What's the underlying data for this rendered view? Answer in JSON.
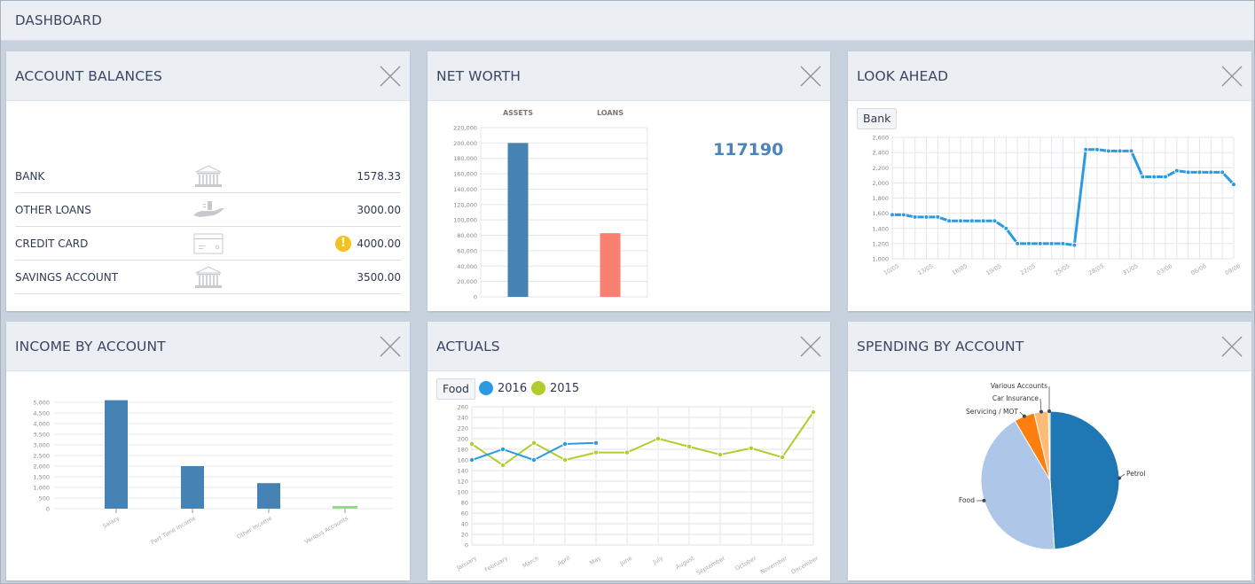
{
  "app": {
    "title": "DASHBOARD"
  },
  "colors": {
    "accent": "#4682b4",
    "loans": "#fa8072",
    "series_2016": "#2b9ae2",
    "series_2015": "#b3cc2c",
    "warning": "#f3c220",
    "lookahead_line": "#2b9ae2"
  },
  "panels": {
    "account_balances": {
      "title": "ACCOUNT BALANCES",
      "close_icon": "close-icon",
      "rows": [
        {
          "name": "BANK",
          "icon": "bank-icon",
          "value": "1578.33",
          "warning": false
        },
        {
          "name": "OTHER LOANS",
          "icon": "hand-money-icon",
          "value": "3000.00",
          "warning": false
        },
        {
          "name": "CREDIT CARD",
          "icon": "credit-card-icon",
          "value": "4000.00",
          "warning": true,
          "warning_glyph": "!"
        },
        {
          "name": "SAVINGS ACCOUNT",
          "icon": "bank-icon",
          "value": "3500.00",
          "warning": false
        }
      ]
    },
    "net_worth": {
      "title": "NET WORTH",
      "value": "117190"
    },
    "look_ahead": {
      "title": "LOOK AHEAD",
      "account_tag": "Bank"
    },
    "income_by_account": {
      "title": "INCOME BY ACCOUNT"
    },
    "actuals": {
      "title": "ACTUALS",
      "category_tag": "Food",
      "legend": [
        "2016",
        "2015"
      ]
    },
    "spending_by_account": {
      "title": "SPENDING BY ACCOUNT"
    }
  },
  "chart_data": [
    {
      "id": "net_worth",
      "type": "bar",
      "title": "",
      "categories": [
        "ASSETS",
        "LOANS"
      ],
      "values": [
        200000,
        82810
      ],
      "ylim": [
        0,
        220000
      ],
      "yticks": [
        "0",
        "20,000",
        "40,000",
        "60,000",
        "80,000",
        "100,000",
        "120,000",
        "140,000",
        "160,000",
        "180,000",
        "200,000",
        "220,000"
      ],
      "grid": true
    },
    {
      "id": "look_ahead",
      "type": "line",
      "series": [
        {
          "name": "Bank",
          "values": [
            1580,
            1580,
            1550,
            1550,
            1550,
            1500,
            1500,
            1500,
            1500,
            1500,
            1400,
            1200,
            1200,
            1200,
            1200,
            1200,
            1180,
            2440,
            2440,
            2420,
            2420,
            2420,
            2080,
            2080,
            2080,
            2160,
            2140,
            2140,
            2140,
            2140,
            1980
          ]
        }
      ],
      "x": [
        "10/05",
        "11/05",
        "12/05",
        "13/05",
        "14/05",
        "15/05",
        "16/05",
        "17/05",
        "18/05",
        "19/05",
        "20/05",
        "21/05",
        "22/05",
        "23/05",
        "24/05",
        "25/05",
        "26/05",
        "27/05",
        "28/05",
        "29/05",
        "30/05",
        "31/05",
        "01/06",
        "02/06",
        "03/06",
        "04/06",
        "05/06",
        "06/06",
        "07/06",
        "08/06",
        "09/06"
      ],
      "xticks": [
        "10/05",
        "13/05",
        "16/05",
        "19/05",
        "22/05",
        "25/05",
        "28/05",
        "31/05",
        "03/06",
        "06/06",
        "09/06"
      ],
      "ylim": [
        1000,
        2600
      ],
      "yticks": [
        "1,000",
        "1,200",
        "1,400",
        "1,600",
        "1,800",
        "2,000",
        "2,200",
        "2,400",
        "2,600"
      ],
      "grid": true
    },
    {
      "id": "income_by_account",
      "type": "bar",
      "categories": [
        "Salary",
        "Part Time Income",
        "Other Income",
        "Various Accounts"
      ],
      "values": [
        5100,
        2000,
        1200,
        80
      ],
      "bar_colors": [
        "#4682b4",
        "#4682b4",
        "#4682b4",
        "#90dc82"
      ],
      "ylim": [
        0,
        5000
      ],
      "yticks": [
        "0",
        "500",
        "1,000",
        "1,500",
        "2,000",
        "2,500",
        "3,000",
        "3,500",
        "4,000",
        "4,500",
        "5,000"
      ],
      "grid": true
    },
    {
      "id": "actuals",
      "type": "line",
      "categories": [
        "January",
        "February",
        "March",
        "April",
        "May",
        "June",
        "July",
        "August",
        "September",
        "October",
        "November",
        "December"
      ],
      "series": [
        {
          "name": "2016",
          "values": [
            160,
            180,
            160,
            190,
            192,
            null,
            null,
            null,
            null,
            null,
            null,
            null
          ]
        },
        {
          "name": "2015",
          "values": [
            190,
            150,
            192,
            160,
            174,
            174,
            200,
            185,
            170,
            182,
            165,
            250
          ]
        }
      ],
      "ylim": [
        0,
        260
      ],
      "yticks": [
        "0",
        "20",
        "40",
        "60",
        "80",
        "100",
        "120",
        "140",
        "160",
        "180",
        "200",
        "220",
        "240",
        "260"
      ],
      "legend": "top-left",
      "grid": true
    },
    {
      "id": "spending_by_account",
      "type": "pie",
      "slices": [
        {
          "label": "Petrol",
          "value": 49.0,
          "color": "#1f77b4"
        },
        {
          "label": "Food",
          "value": 42.5,
          "color": "#aec7e8"
        },
        {
          "label": "Servicing / MOT",
          "value": 4.8,
          "color": "#ff7f0e"
        },
        {
          "label": "Car Insurance",
          "value": 3.3,
          "color": "#ffbb78"
        },
        {
          "label": "Various Accounts",
          "value": 0.4,
          "color": "#98df8a"
        }
      ]
    }
  ]
}
